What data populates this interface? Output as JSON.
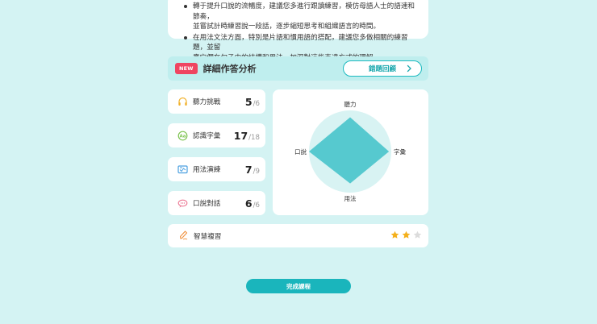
{
  "tips": [
    "轉于提升口說的流暢度，建議您多進行跟讀練習，模仿母語人士的語速和節奏，\n並嘗試計時練習說一段話，逐步縮短思考和組織語言的時間。",
    "在用法文法方面，特別是片語和慣用語的搭配，建議您多做相關的練習題，並留\n意它們在句子中的結構和用法，加深對這些表達方式的理解。"
  ],
  "header": {
    "badge": "NEW",
    "title": "詳細作答分析",
    "review_label": "錯題回顧"
  },
  "stats": [
    {
      "label": "聽力挑戰",
      "value": "5",
      "total": "/6",
      "icon": "headphones-icon"
    },
    {
      "label": "認識字彙",
      "value": "17",
      "total": "/18",
      "icon": "vocabulary-icon"
    },
    {
      "label": "用法演練",
      "value": "7",
      "total": "/9",
      "icon": "usage-practice-icon"
    },
    {
      "label": "口說對話",
      "value": "6",
      "total": "/6",
      "icon": "speech-bubble-icon"
    }
  ],
  "radar": {
    "axes": [
      "聽力",
      "字彙",
      "用法",
      "口說"
    ],
    "scores": [
      0.833,
      0.944,
      0.778,
      1.0
    ]
  },
  "smart_review": {
    "label": "智慧複習",
    "rating": 2,
    "max_rating": 3
  },
  "finish_label": "完成課程",
  "colors": {
    "accent": "#1ab5bc",
    "radar_fill": "#56c9cf",
    "radar_bg": "#d8f3f3",
    "star": "#f4b01c",
    "star_empty": "#dcdcdc",
    "badge": "#ef4561"
  }
}
